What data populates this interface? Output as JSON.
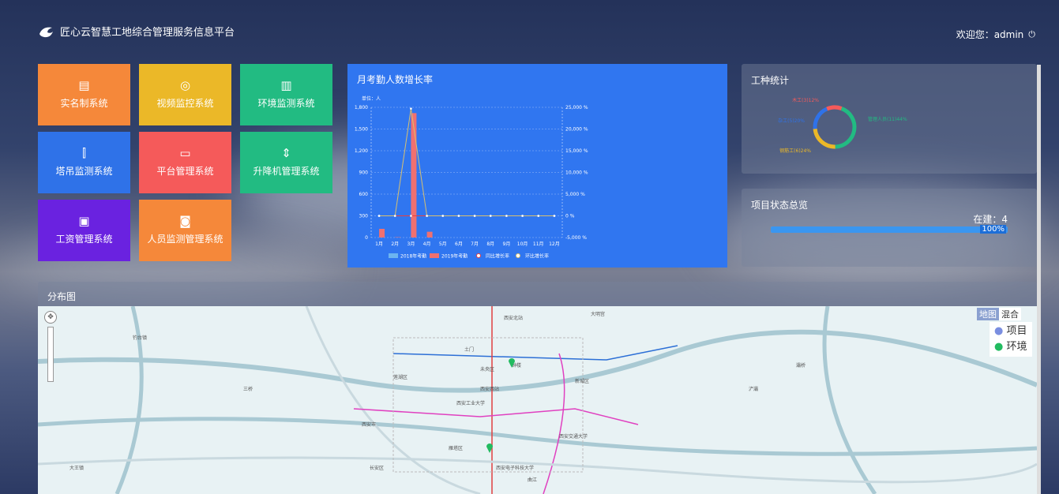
{
  "header": {
    "title": "匠心云智慧工地综合管理服务信息平台",
    "welcome": "欢迎您：admin",
    "logout_icon": "power-icon"
  },
  "tiles": [
    {
      "label": "实名制系统",
      "color": "#f5883a",
      "icon": "id-card-icon"
    },
    {
      "label": "视频监控系统",
      "color": "#ebb828",
      "icon": "camera-icon"
    },
    {
      "label": "环境监测系统",
      "color": "#22bb82",
      "icon": "bar-chart-icon"
    },
    {
      "label": "塔吊监测系统",
      "color": "#2f72e8",
      "icon": "crane-icon"
    },
    {
      "label": "平台管理系统",
      "color": "#f55a5a",
      "icon": "monitor-icon"
    },
    {
      "label": "升降机管理系统",
      "color": "#22bb82",
      "icon": "elevator-icon"
    },
    {
      "label": "工资管理系统",
      "color": "#6a22e0",
      "icon": "salary-icon"
    },
    {
      "label": "人员监测管理系统",
      "color": "#f5883a",
      "icon": "face-scan-icon"
    }
  ],
  "attendance": {
    "title": "月考勤人数增长率"
  },
  "chart_data": {
    "type": "bar",
    "title": "月考勤人数增长率",
    "unit_label": "单位：人",
    "categories": [
      "1月",
      "2月",
      "3月",
      "4月",
      "5月",
      "6月",
      "7月",
      "8月",
      "9月",
      "10月",
      "11月",
      "12月"
    ],
    "ylim": [
      0,
      1800
    ],
    "yticks": [
      "0",
      "300",
      "600",
      "900",
      "1,200",
      "1,500",
      "1,800"
    ],
    "y2lim": [
      -5000,
      25000
    ],
    "y2ticks": [
      "-5,000 %",
      "0 %",
      "5,000 %",
      "10,000 %",
      "15,000 %",
      "20,000 %",
      "25,000 %"
    ],
    "series": [
      {
        "name": "2018年考勤",
        "type": "bar",
        "color": "#6cb4f0",
        "values": [
          0,
          0,
          0,
          0,
          0,
          0,
          0,
          0,
          0,
          0,
          0,
          0
        ]
      },
      {
        "name": "2019年考勤",
        "type": "bar",
        "color": "#f07070",
        "values": [
          120,
          5,
          1720,
          80,
          0,
          0,
          0,
          0,
          0,
          0,
          0,
          0
        ]
      },
      {
        "name": "同比增长率",
        "type": "line",
        "axis": "right",
        "color": "#e84040",
        "values": [
          0,
          0,
          0,
          0,
          0,
          0,
          0,
          0,
          0,
          0,
          0,
          0
        ]
      },
      {
        "name": "环比增长率",
        "type": "line",
        "axis": "right",
        "color": "#d8c070",
        "values": [
          0,
          0,
          24700,
          0,
          0,
          0,
          0,
          0,
          0,
          0,
          0,
          0
        ]
      }
    ],
    "grid": true,
    "legend": "bottom"
  },
  "worktype": {
    "title": "工种统计",
    "chart_data": {
      "type": "pie",
      "donut": true,
      "slices": [
        {
          "label": "管理人员(11)44%",
          "value": 11,
          "color": "#22bb82"
        },
        {
          "label": "钢筋工(6)24%",
          "value": 6,
          "color": "#ebb828"
        },
        {
          "label": "杂工(5)20%",
          "value": 5,
          "color": "#2f72e8"
        },
        {
          "label": "木工(3)12%",
          "value": 3,
          "color": "#f55a5a"
        }
      ]
    }
  },
  "status": {
    "title": "项目状态总览",
    "label": "在建：4",
    "percent": 100,
    "percent_label": "100%"
  },
  "map": {
    "title": "分布图",
    "type_map": "地图",
    "type_hybrid": "混合",
    "legend": [
      {
        "label": "项目",
        "color": "#7a8ee0"
      },
      {
        "label": "环境",
        "color": "#22bb60"
      }
    ],
    "places": [
      "土门",
      "西安西站",
      "西安工业大学",
      "西安北站",
      "大明宫",
      "钟楼",
      "西安交通大学",
      "曲江",
      "浐灞",
      "西安电子科技大学",
      "未央区",
      "灞桥",
      "长安区",
      "大王镇",
      "钓台镇",
      "三桥",
      "西安市",
      "雁塔区",
      "莲湖区",
      "新城区"
    ]
  }
}
